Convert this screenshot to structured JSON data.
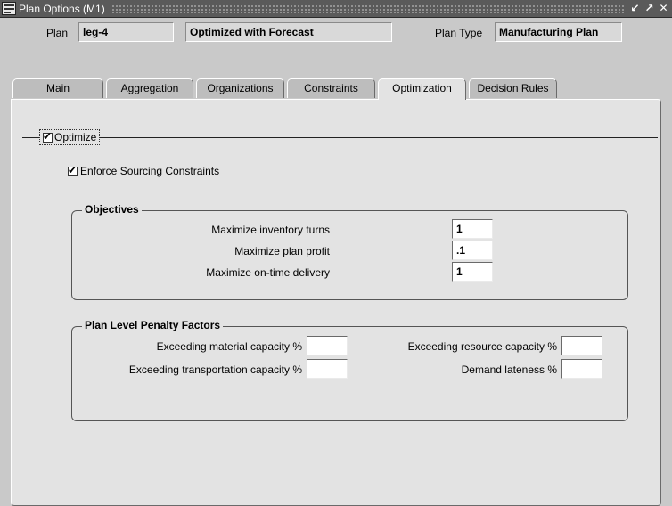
{
  "window": {
    "title": "Plan Options (M1)"
  },
  "header": {
    "plan_label": "Plan",
    "plan_value": "leg-4",
    "plan_description": "Optimized with Forecast",
    "plan_type_label": "Plan Type",
    "plan_type_value": "Manufacturing Plan"
  },
  "tabs": [
    {
      "label": "Main",
      "active": false
    },
    {
      "label": "Aggregation",
      "active": false
    },
    {
      "label": "Organizations",
      "active": false
    },
    {
      "label": "Constraints",
      "active": false
    },
    {
      "label": "Optimization",
      "active": true
    },
    {
      "label": "Decision Rules",
      "active": false
    }
  ],
  "optimization": {
    "optimize_label": "Optimize",
    "optimize_checked": true,
    "enforce_sourcing_label": "Enforce Sourcing Constraints",
    "enforce_sourcing_checked": true,
    "objectives": {
      "title": "Objectives",
      "fields": [
        {
          "label": "Maximize inventory turns",
          "value": "1"
        },
        {
          "label": "Maximize plan profit",
          "value": ".1"
        },
        {
          "label": "Maximize on-time delivery",
          "value": "1"
        }
      ]
    },
    "penalty": {
      "title": "Plan Level Penalty Factors",
      "material_label": "Exceeding material capacity %",
      "material_value": "",
      "transportation_label": "Exceeding transportation capacity %",
      "transportation_value": "",
      "resource_label": "Exceeding resource capacity %",
      "resource_value": "",
      "lateness_label": "Demand lateness %",
      "lateness_value": ""
    }
  },
  "colors": {
    "titlebar": "#5a5a5a",
    "background": "#c9c9c9",
    "panel": "#e3e3e3"
  }
}
